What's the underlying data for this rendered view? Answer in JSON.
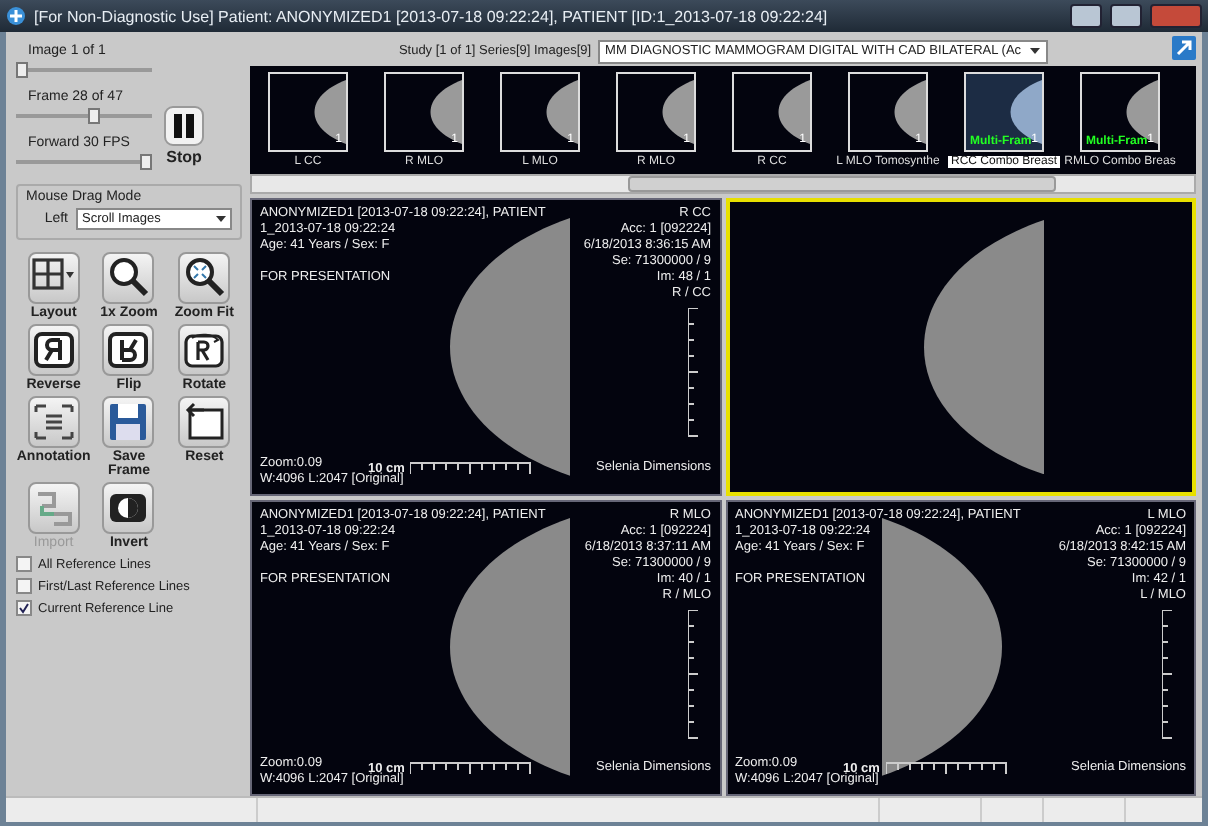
{
  "window": {
    "title": "[For Non-Diagnostic Use] Patient: ANONYMIZED1 [2013-07-18 09:22:24], PATIENT [ID:1_2013-07-18 09:22:24]"
  },
  "controls": {
    "sliders": [
      {
        "label": "Image 1 of 1",
        "level": 0
      },
      {
        "label": "Frame 28 of 47",
        "level": 0.58
      },
      {
        "label": "Forward 30 FPS",
        "level": 1
      }
    ],
    "stop_button": {
      "label": "Stop"
    }
  },
  "mouse_drag_mode": {
    "title": "Mouse Drag Mode",
    "label": "Left",
    "value": "Scroll Images"
  },
  "tools": [
    {
      "label": "Layout",
      "kind": "layout",
      "disabled": false
    },
    {
      "label": "1x Zoom",
      "kind": "zoom",
      "disabled": false
    },
    {
      "label": "Zoom Fit",
      "kind": "zoomfit",
      "disabled": false
    },
    {
      "label": "Reverse",
      "kind": "reverse",
      "disabled": false
    },
    {
      "label": "Flip",
      "kind": "flip",
      "disabled": false
    },
    {
      "label": "Rotate",
      "kind": "rotate",
      "disabled": false
    },
    {
      "label": "Annotation",
      "kind": "annotation",
      "disabled": false
    },
    {
      "label": "Save Frame",
      "kind": "save",
      "disabled": false
    },
    {
      "label": "Reset",
      "kind": "reset",
      "disabled": false
    },
    {
      "label": "Import",
      "kind": "import",
      "disabled": true
    },
    {
      "label": "Invert",
      "kind": "invert",
      "disabled": false
    }
  ],
  "checkboxes": [
    {
      "label": "All Reference Lines",
      "checked": false
    },
    {
      "label": "First/Last Reference Lines",
      "checked": false
    },
    {
      "label": "Current Reference Line",
      "checked": true
    }
  ],
  "study_bar": {
    "label": "Study [1 of 1] Series[9] Images[9]",
    "value": "MM DIAGNOSTIC MAMMOGRAM DIGITAL WITH CAD BILATERAL (Ac"
  },
  "thumbnails": [
    {
      "label": "L CC",
      "count": "1",
      "selected": false
    },
    {
      "label": "R MLO",
      "count": "1",
      "selected": false
    },
    {
      "label": "L MLO",
      "count": "1",
      "selected": false
    },
    {
      "label": "R MLO",
      "count": "1",
      "selected": false
    },
    {
      "label": "R CC",
      "count": "1",
      "selected": false
    },
    {
      "label": "L MLO Tomosynthe",
      "count": "1",
      "selected": false
    },
    {
      "label": "RCC Combo Breast",
      "count": "1",
      "selected": true,
      "badge": "Multi-Fram"
    },
    {
      "label": "RMLO Combo Breas",
      "count": "1",
      "selected": false,
      "badge": "Multi-Fram"
    }
  ],
  "viewports": [
    {
      "selected": false,
      "top_left": [
        "ANONYMIZED1 [2013-07-18 09:22:24], PATIENT",
        "1_2013-07-18 09:22:24",
        "Age: 41 Years / Sex: F",
        "FOR PRESENTATION"
      ],
      "top_right": [
        "R CC",
        "Acc: 1 [092224]",
        "6/18/2013 8:36:15 AM",
        "Se: 71300000 / 9",
        "Im: 48 / 1",
        "R / CC"
      ],
      "zoom": "Zoom:0.09",
      "window_level": "W:4096  L:2047 [Original]",
      "scale": "10 cm",
      "device": "Selenia Dimensions"
    },
    {
      "selected": true
    },
    {
      "selected": false,
      "top_left": [
        "ANONYMIZED1 [2013-07-18 09:22:24], PATIENT",
        "1_2013-07-18 09:22:24",
        "Age: 41 Years / Sex: F",
        "FOR PRESENTATION"
      ],
      "top_right": [
        "R MLO",
        "Acc: 1 [092224]",
        "6/18/2013 8:37:11 AM",
        "Se: 71300000 / 9",
        "Im: 40 / 1",
        "R / MLO"
      ],
      "zoom": "Zoom:0.09",
      "window_level": "W:4096  L:2047 [Original]",
      "scale": "10 cm",
      "device": "Selenia Dimensions"
    },
    {
      "selected": false,
      "top_left": [
        "ANONYMIZED1 [2013-07-18 09:22:24], PATIENT",
        "1_2013-07-18 09:22:24",
        "Age: 41 Years / Sex: F",
        "FOR PRESENTATION"
      ],
      "top_right": [
        "L MLO",
        "Acc: 1 [092224]",
        "6/18/2013 8:42:15 AM",
        "Se: 71300000 / 9",
        "Im: 42 / 1",
        "L / MLO"
      ],
      "zoom": "Zoom:0.09",
      "window_level": "W:4096  L:2047 [Original]",
      "scale": "10 cm",
      "device": "Selenia Dimensions"
    }
  ]
}
